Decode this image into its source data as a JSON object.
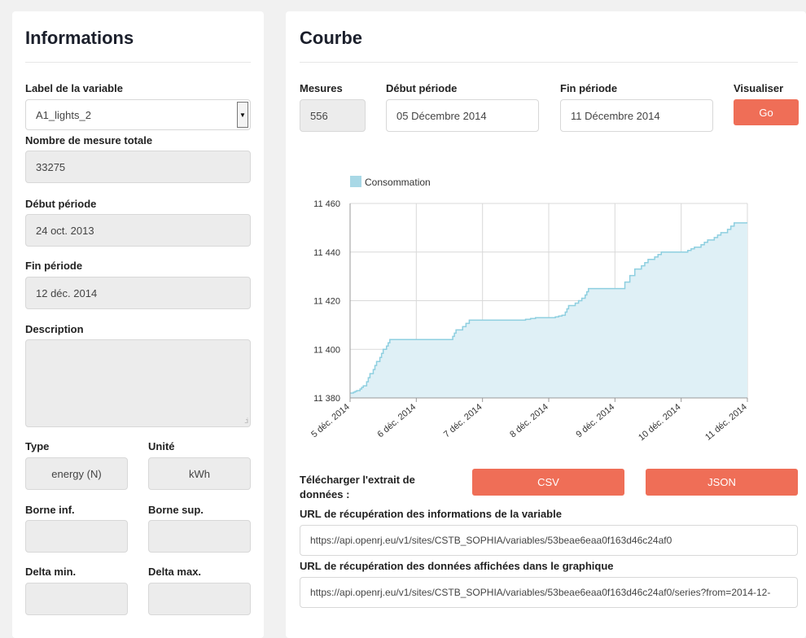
{
  "left": {
    "title": "Informations",
    "label_variable": "Label de la variable",
    "variable_value": "A1_lights_2",
    "nb_mesures_label": "Nombre de mesure totale",
    "nb_mesures_value": "33275",
    "debut_label": "Début période",
    "debut_value": "24 oct. 2013",
    "fin_label": "Fin période",
    "fin_value": "12 déc. 2014",
    "description_label": "Description",
    "description_value": "",
    "type_label": "Type",
    "type_value": "energy (N)",
    "unite_label": "Unité",
    "unite_value": "kWh",
    "borne_inf_label": "Borne inf.",
    "borne_inf_value": "",
    "borne_sup_label": "Borne sup.",
    "borne_sup_value": "",
    "delta_min_label": "Delta min.",
    "delta_min_value": "",
    "delta_max_label": "Delta max.",
    "delta_max_value": ""
  },
  "right": {
    "title": "Courbe",
    "mesures_label": "Mesures",
    "mesures_value": "556",
    "debut_label": "Début période",
    "debut_value": "05 Décembre 2014",
    "fin_label": "Fin période",
    "fin_value": "11 Décembre 2014",
    "visualiser_label": "Visualiser",
    "go_label": "Go",
    "telecharger_label_1": "Télécharger l'extrait de",
    "telecharger_label_2": "données :",
    "csv_label": "CSV",
    "json_label": "JSON",
    "url_info_label": "URL de récupération des informations de la variable",
    "url_info_value": "https://api.openrj.eu/v1/sites/CSTB_SOPHIA/variables/53beae6eaa0f163d46c24af0",
    "url_data_label": "URL de récupération des données affichées dans le graphique",
    "url_data_value": "https://api.openrj.eu/v1/sites/CSTB_SOPHIA/variables/53beae6eaa0f163d46c24af0/series?from=2014-12-"
  },
  "colors": {
    "accent": "#ef6e57",
    "series_line": "#8ecfe0",
    "series_fill": "#dff0f6",
    "legend_swatch": "#a8d8e6"
  },
  "chart_data": {
    "type": "area",
    "legend": "Consommation",
    "legend_placement": "top-left",
    "grid": true,
    "x_tick_labels": [
      "5 déc. 2014",
      "6 déc. 2014",
      "7 déc. 2014",
      "8 déc. 2014",
      "9 déc. 2014",
      "10 déc. 2014",
      "11 déc. 2014"
    ],
    "y_tick_labels": [
      "11 380",
      "11 400",
      "11 420",
      "11 440",
      "11 460"
    ],
    "ylim": [
      11380,
      11460
    ],
    "xlim": [
      0,
      6
    ],
    "series": [
      {
        "name": "Consommation",
        "x": [
          0,
          0.1,
          0.2,
          0.3,
          0.4,
          0.5,
          0.6,
          0.8,
          1.0,
          1.5,
          1.6,
          1.8,
          2.0,
          2.5,
          2.8,
          3.0,
          3.2,
          3.3,
          3.5,
          3.6,
          3.8,
          4.0,
          4.3,
          4.5,
          4.7,
          4.9,
          5.0,
          5.2,
          5.4,
          5.6,
          5.8,
          6.0
        ],
        "y": [
          11382,
          11383,
          11385,
          11390,
          11395,
          11400,
          11404,
          11404,
          11404,
          11404,
          11408,
          11412,
          11412,
          11412,
          11413,
          11413,
          11414,
          11418,
          11421,
          11425,
          11425,
          11425,
          11433,
          11437,
          11440,
          11440,
          11440,
          11442,
          11445,
          11448,
          11452,
          11452
        ]
      }
    ]
  }
}
